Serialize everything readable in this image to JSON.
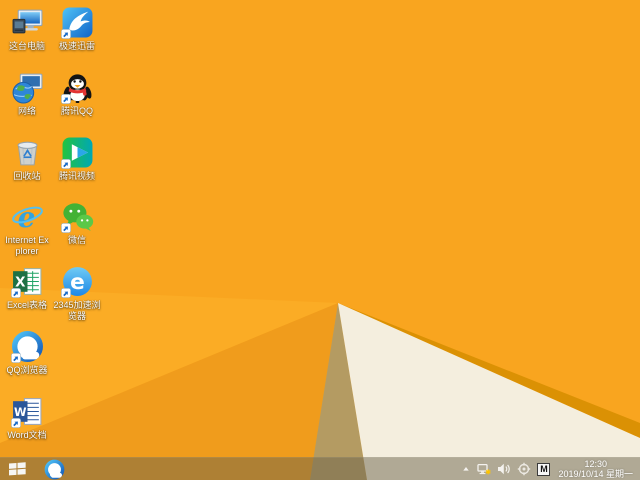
{
  "wallpaper": {
    "base": "#F9A51F",
    "facet_light": "#FBAC25",
    "facet_dark": "#F09C1C",
    "shadow_tan": "#B49B62",
    "fold_band": "#DB9104",
    "cream": "#F4EEDE"
  },
  "desktop": {
    "icons": [
      {
        "id": "this-pc",
        "label": "这台电脑",
        "col": 1,
        "row": 1,
        "shortcut": false
      },
      {
        "id": "xunlei",
        "label": "极速迅雷",
        "col": 2,
        "row": 1,
        "shortcut": true
      },
      {
        "id": "network",
        "label": "网络",
        "col": 1,
        "row": 2,
        "shortcut": false
      },
      {
        "id": "qq",
        "label": "腾讯QQ",
        "col": 2,
        "row": 2,
        "shortcut": true
      },
      {
        "id": "recycle-bin",
        "label": "回收站",
        "col": 1,
        "row": 3,
        "shortcut": false
      },
      {
        "id": "tencent-video",
        "label": "腾讯视频",
        "col": 2,
        "row": 3,
        "shortcut": true
      },
      {
        "id": "ie",
        "label": "Internet Explorer",
        "col": 1,
        "row": 4,
        "shortcut": false
      },
      {
        "id": "wechat",
        "label": "微信",
        "col": 2,
        "row": 4,
        "shortcut": true
      },
      {
        "id": "excel",
        "label": "Excel表格",
        "col": 1,
        "row": 5,
        "shortcut": true
      },
      {
        "id": "browser-2345",
        "label": "2345加速浏览器",
        "col": 2,
        "row": 5,
        "shortcut": true
      },
      {
        "id": "qq-browser",
        "label": "QQ浏览器",
        "col": 1,
        "row": 6,
        "shortcut": true
      },
      {
        "id": "word",
        "label": "Word文档",
        "col": 1,
        "row": 7,
        "shortcut": true
      }
    ]
  },
  "taskbar": {
    "pinned": [
      {
        "id": "qq-browser",
        "name": "qq-browser"
      }
    ],
    "tray": {
      "icons": [
        {
          "id": "chevron-up",
          "name": "show-hidden-icons"
        },
        {
          "id": "network-warning",
          "name": "network-status"
        },
        {
          "id": "volume",
          "name": "volume"
        },
        {
          "id": "safety",
          "name": "safety-center"
        },
        {
          "id": "ime",
          "name": "input-method-indicator",
          "label": "M"
        }
      ],
      "clock": {
        "time": "12:30",
        "date": "2019/10/14 星期一"
      }
    }
  }
}
